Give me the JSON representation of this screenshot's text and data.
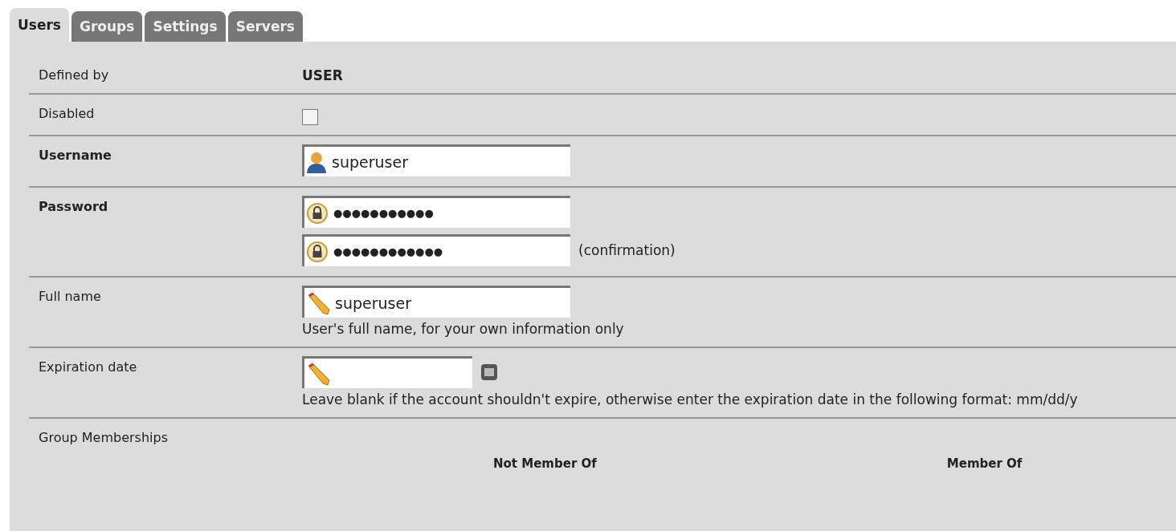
{
  "tabs": [
    {
      "label": "Users",
      "selected": true
    },
    {
      "label": "Groups",
      "selected": false
    },
    {
      "label": "Settings",
      "selected": false
    },
    {
      "label": "Servers",
      "selected": false
    }
  ],
  "rows": [
    {
      "kind": "text",
      "label": "Defined by",
      "required": false,
      "value": "USER"
    },
    {
      "kind": "checkbox",
      "label": "Disabled",
      "required": false,
      "checked": false
    },
    {
      "kind": "username",
      "label": "Username",
      "required": true,
      "value": "superuser"
    },
    {
      "kind": "password",
      "label": "Password",
      "required": true,
      "value": "●●●●●●●●●●●",
      "confirm_value": "●●●●●●●●●●●●",
      "confirm_note": "(confirmation)"
    },
    {
      "kind": "fullname",
      "label": "Full name",
      "required": false,
      "value": "superuser",
      "hint": "User's full name, for your own information only"
    },
    {
      "kind": "date",
      "label": "Expiration date",
      "required": false,
      "hint": "Leave blank if the account shouldn't expire, otherwise enter the expiration date in the following format: mm/dd/y"
    },
    {
      "kind": "groups",
      "label": "Group Memberships",
      "required": false,
      "left_heading": "Not Member Of",
      "right_heading": "Member Of"
    }
  ]
}
